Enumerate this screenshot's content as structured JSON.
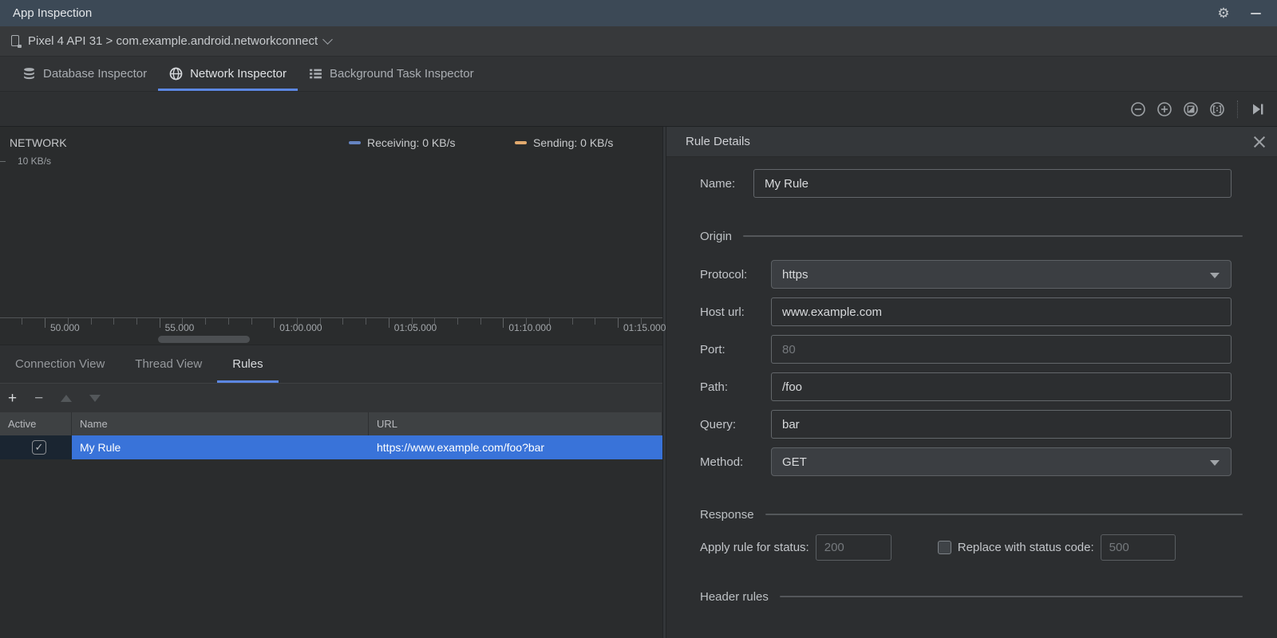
{
  "window": {
    "title": "App Inspection"
  },
  "icons": {
    "settings_glyph": "⚙"
  },
  "device_bar": {
    "text": "Pixel 4 API 31 > com.example.android.networkconnect"
  },
  "inspector_tabs": {
    "active_index": 1,
    "tabs": [
      {
        "label": "Database Inspector",
        "icon": "database-icon"
      },
      {
        "label": "Network Inspector",
        "icon": "globe-icon"
      },
      {
        "label": "Background Task Inspector",
        "icon": "task-list-icon"
      }
    ]
  },
  "network_section": {
    "title": "NETWORK",
    "y_axis_label": "10 KB/s",
    "legend": [
      {
        "label": "Receiving: 0 KB/s",
        "color": "#6584c2"
      },
      {
        "label": "Sending: 0 KB/s",
        "color": "#e2aa6e"
      }
    ],
    "timeline_labels": [
      "50.000",
      "55.000",
      "01:00.000",
      "01:05.000",
      "01:10.000",
      "01:15.000"
    ]
  },
  "view_tabs": {
    "active_index": 2,
    "tabs": [
      "Connection View",
      "Thread View",
      "Rules"
    ]
  },
  "rules_table": {
    "columns": [
      "Active",
      "Name",
      "URL"
    ],
    "rows": [
      {
        "active": true,
        "name": "My Rule",
        "url": "https://www.example.com/foo?bar",
        "selected": true
      }
    ]
  },
  "rule_details": {
    "title": "Rule Details",
    "name_field": {
      "label": "Name:",
      "value": "My Rule"
    },
    "sections": {
      "origin": "Origin",
      "response": "Response",
      "header_rules": "Header rules"
    },
    "origin_fields": [
      {
        "label": "Protocol:",
        "type": "select",
        "value": "https"
      },
      {
        "label": "Host url:",
        "type": "text",
        "value": "www.example.com"
      },
      {
        "label": "Port:",
        "type": "text",
        "placeholder": "80"
      },
      {
        "label": "Path:",
        "type": "text",
        "value": "/foo"
      },
      {
        "label": "Query:",
        "type": "text",
        "value": "bar"
      },
      {
        "label": "Method:",
        "type": "select",
        "value": "GET"
      }
    ],
    "response": {
      "apply_label": "Apply rule for status:",
      "apply_placeholder": "200",
      "replace_checked": false,
      "replace_label": "Replace with status code:",
      "replace_placeholder": "500"
    }
  },
  "colors": {
    "titlebar": "#3c4956",
    "selection_blue": "#3973d9",
    "tab_underline": "#5c87e2",
    "receiving": "#6584c2",
    "sending": "#e2aa6e"
  }
}
